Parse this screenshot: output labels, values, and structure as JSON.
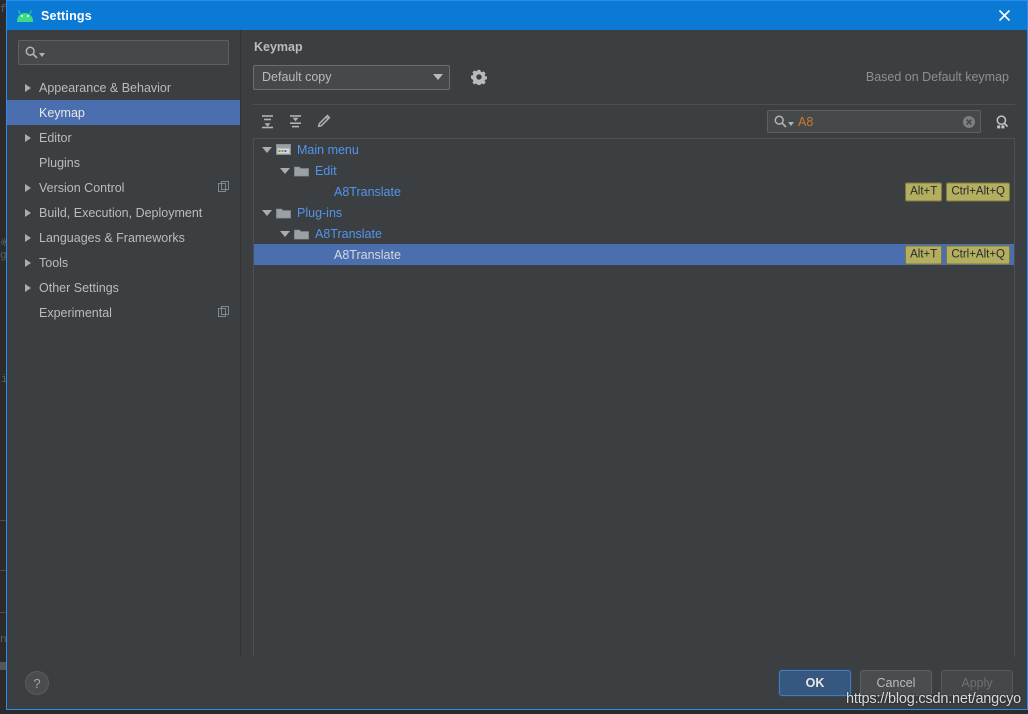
{
  "window": {
    "title": "Settings",
    "app_icon": "android-icon",
    "close_icon": "close-icon",
    "titlebar_color": "#0b7ad4"
  },
  "sidebar": {
    "search": {
      "value": "",
      "placeholder": "",
      "icon": "search-icon"
    },
    "items": [
      {
        "label": "Appearance & Behavior",
        "expandable": true,
        "selected": false,
        "badge": false
      },
      {
        "label": "Keymap",
        "expandable": false,
        "selected": true,
        "badge": false
      },
      {
        "label": "Editor",
        "expandable": true,
        "selected": false,
        "badge": false
      },
      {
        "label": "Plugins",
        "expandable": false,
        "selected": false,
        "badge": false
      },
      {
        "label": "Version Control",
        "expandable": true,
        "selected": false,
        "badge": true
      },
      {
        "label": "Build, Execution, Deployment",
        "expandable": true,
        "selected": false,
        "badge": false
      },
      {
        "label": "Languages & Frameworks",
        "expandable": true,
        "selected": false,
        "badge": false
      },
      {
        "label": "Tools",
        "expandable": true,
        "selected": false,
        "badge": false
      },
      {
        "label": "Other Settings",
        "expandable": true,
        "selected": false,
        "badge": false
      },
      {
        "label": "Experimental",
        "expandable": false,
        "selected": false,
        "badge": true
      }
    ]
  },
  "main": {
    "title": "Keymap",
    "keymap_select": {
      "value": "Default copy"
    },
    "gear_icon": "gear-icon",
    "based_on": "Based on Default keymap",
    "toolbar": [
      {
        "icon": "expand-all-icon",
        "name": "expand-all-button"
      },
      {
        "icon": "collapse-all-icon",
        "name": "collapse-all-button"
      },
      {
        "icon": "edit-pencil-icon",
        "name": "edit-shortcut-button"
      }
    ],
    "find": {
      "value": "A8",
      "search_icon": "search-icon",
      "clear_icon": "clear-icon",
      "by_shortcut_icon": "find-by-shortcut-icon",
      "text_color": "#cc7832"
    },
    "tree": [
      {
        "label": "Main menu",
        "depth": 0,
        "arrow": "down",
        "icon": "menu-bar-icon",
        "selected": false,
        "shortcuts": []
      },
      {
        "label": "Edit",
        "depth": 1,
        "arrow": "down",
        "icon": "folder-icon",
        "selected": false,
        "shortcuts": []
      },
      {
        "label": "A8Translate",
        "depth": 2,
        "arrow": "none",
        "icon": "none",
        "selected": false,
        "shortcuts": [
          "Alt+T",
          "Ctrl+Alt+Q"
        ]
      },
      {
        "label": "Plug-ins",
        "depth": 0,
        "arrow": "down",
        "icon": "folder-icon",
        "selected": false,
        "shortcuts": []
      },
      {
        "label": "A8Translate",
        "depth": 1,
        "arrow": "down",
        "icon": "folder-icon",
        "selected": false,
        "shortcuts": []
      },
      {
        "label": "A8Translate",
        "depth": 2,
        "arrow": "none",
        "icon": "none",
        "selected": true,
        "shortcuts": [
          "Alt+T",
          "Ctrl+Alt+Q"
        ]
      }
    ]
  },
  "footer": {
    "help_label": "?",
    "ok_label": "OK",
    "cancel_label": "Cancel",
    "apply_label": "Apply",
    "apply_disabled": true
  },
  "watermark": "https://blog.csdn.net/angcyo",
  "backdrop": {
    "glyphs": [
      "f",
      "g",
      "i",
      "nt"
    ]
  }
}
